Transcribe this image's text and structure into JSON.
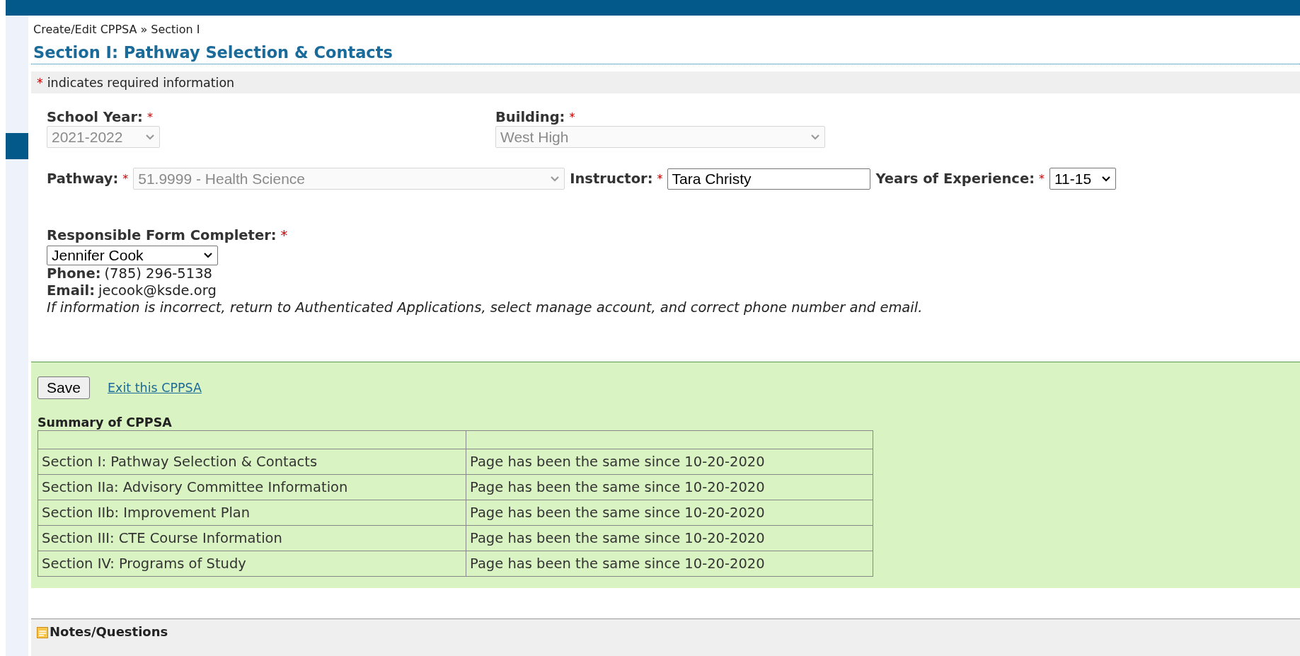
{
  "breadcrumb": {
    "items": [
      "Create/Edit CPPSA",
      "Section I"
    ],
    "separator": "»"
  },
  "title": "Section I: Pathway Selection & Contacts",
  "required_marker": "*",
  "required_note": "indicates required information",
  "rows": [
    {
      "kind": "stacked",
      "fields": [
        {
          "label": "School Year:",
          "required": true,
          "kind": "dropdown",
          "value": "2021-2022",
          "disabled": true
        },
        {
          "label": "Building:",
          "required": true,
          "kind": "dropdown",
          "value": "West High",
          "disabled": true
        }
      ]
    },
    {
      "kind": "inline",
      "fields": [
        {
          "label": "Pathway:",
          "required": true,
          "kind": "dropdown",
          "value": "51.9999 - Health Science",
          "disabled": true
        },
        {
          "label": "Instructor:",
          "required": true,
          "kind": "text",
          "value": "Tara Christy",
          "disabled": false
        },
        {
          "label": "Years of Experience:",
          "required": true,
          "kind": "dropdown",
          "value": "11-15",
          "disabled": false
        }
      ]
    }
  ],
  "completer": {
    "label": "Responsible Form Completer:",
    "required": true,
    "value": "Jennifer Cook",
    "disabled": false,
    "details": [
      {
        "label": "Phone:",
        "value": "(785) 296-5138"
      },
      {
        "label": "Email:",
        "value": "jecook@ksde.org"
      }
    ],
    "note": "If information is incorrect, return to Authenticated Applications, select manage account, and correct phone number and email."
  },
  "actions": {
    "save": "Save",
    "exit_link": "Exit this CPPSA"
  },
  "summary": {
    "title": "Summary of CPPSA",
    "rows": [
      {
        "section": "Section I: Pathway Selection & Contacts",
        "status": "Page has been the same since 10-20-2020"
      },
      {
        "section": "Section IIa: Advisory Committee Information",
        "status": "Page has been the same since 10-20-2020"
      },
      {
        "section": "Section IIb: Improvement Plan",
        "status": "Page has been the same since 10-20-2020"
      },
      {
        "section": "Section III: CTE Course Information",
        "status": "Page has been the same since 10-20-2020"
      },
      {
        "section": "Section IV: Programs of Study",
        "status": "Page has been the same since 10-20-2020"
      }
    ]
  },
  "notes": {
    "title": "Notes/Questions"
  }
}
